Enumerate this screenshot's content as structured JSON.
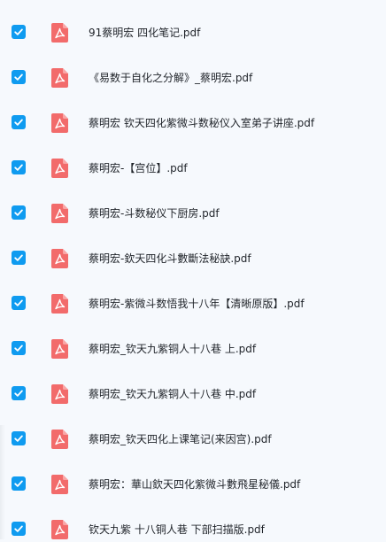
{
  "colors": {
    "checkbox": "#0f9bf0",
    "pdf_icon": "#f26b6b",
    "text": "#1f2329",
    "background": "#f6f9fd"
  },
  "icons": {
    "checkbox": "checkmark-icon",
    "file": "pdf-file-icon"
  },
  "files": [
    {
      "name": "91蔡明宏 四化笔记.pdf",
      "checked": true
    },
    {
      "name": "《易数于自化之分解》_蔡明宏.pdf",
      "checked": true
    },
    {
      "name": "蔡明宏 钦天四化紫微斗数秘仪入室弟子讲座.pdf",
      "checked": true
    },
    {
      "name": "蔡明宏-【宫位】.pdf",
      "checked": true
    },
    {
      "name": "蔡明宏-斗数秘仪下厨房.pdf",
      "checked": true
    },
    {
      "name": "蔡明宏-欽天四化斗數斷法秘訣.pdf",
      "checked": true
    },
    {
      "name": "蔡明宏-紫微斗数悟我十八年【清晰原版】.pdf",
      "checked": true
    },
    {
      "name": "蔡明宏_钦天九紫铜人十八巷 上.pdf",
      "checked": true
    },
    {
      "name": "蔡明宏_钦天九紫铜人十八巷 中.pdf",
      "checked": true
    },
    {
      "name": "蔡明宏_钦天四化上课笔记(来因宫).pdf",
      "checked": true
    },
    {
      "name": "蔡明宏：華山欽天四化紫微斗數飛星秘儀.pdf",
      "checked": true
    },
    {
      "name": "钦天九紫 十八铜人巷 下部扫描版.pdf",
      "checked": true
    }
  ]
}
